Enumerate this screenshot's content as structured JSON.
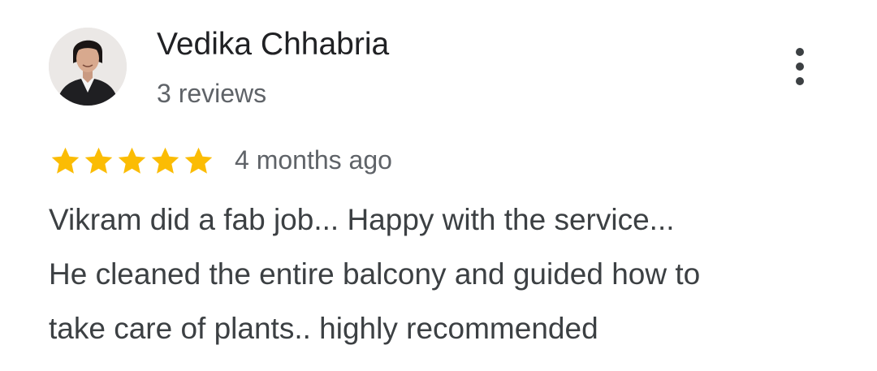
{
  "review": {
    "author": {
      "name": "Vedika Chhabria",
      "review_count": "3 reviews",
      "avatar_icon": "profile-photo"
    },
    "more_options_icon": "vertical-ellipsis-icon",
    "rating": {
      "value": 5,
      "max": 5,
      "star_color": "#FBBC04"
    },
    "time_ago": "4 months ago",
    "text_lines": [
      "Vikram did a fab job... Happy with the service...",
      "He cleaned the entire balcony and guided how to",
      "take care of plants.. highly recommended"
    ]
  }
}
